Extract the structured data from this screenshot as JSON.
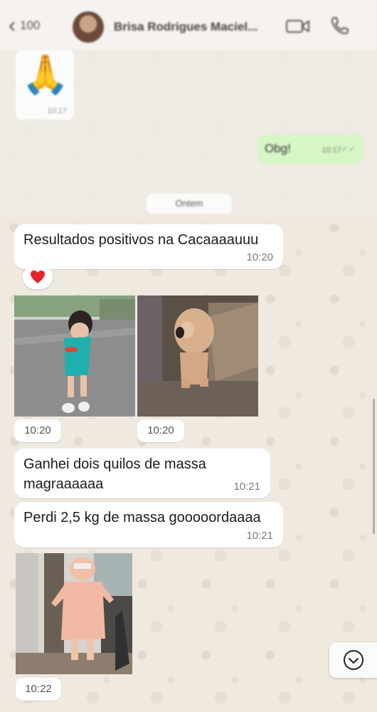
{
  "header": {
    "back_count": "100",
    "contact_name": "Brisa Rodrigues Maciel..."
  },
  "blurred": {
    "sticker_time": "10:17",
    "sent_text": "Obg!",
    "sent_time": "10:17",
    "date_label": "Ontem"
  },
  "messages": [
    {
      "text": "Resultados positivos na Cacaaaauuu",
      "time": "10:20"
    },
    {
      "text": "Ganhei dois quilos de massa magraaaaaa",
      "time": "10:21"
    },
    {
      "text": "Perdi 2,5 kg de massa gooooordaaaa",
      "time": "10:21"
    }
  ],
  "reaction": "❤️",
  "photos": {
    "girl_time": "10:20",
    "dog_time": "10:20",
    "robe_time": "10:22"
  },
  "colors": {
    "chat_bg": "#efeae2",
    "sent_bubble": "#d7f6c6",
    "received_bubble": "#ffffff"
  }
}
